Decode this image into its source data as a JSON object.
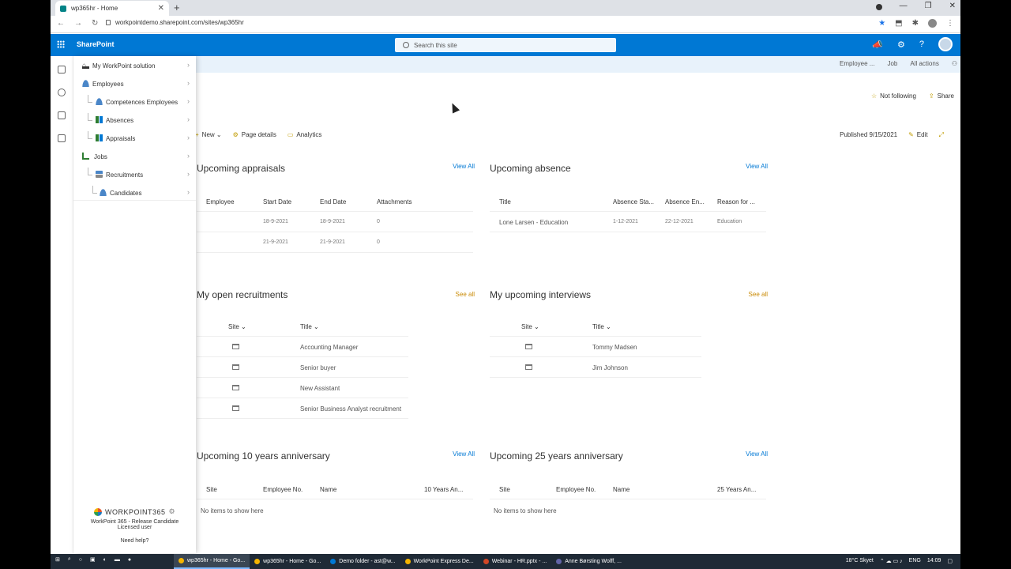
{
  "browser": {
    "tab_title": "wp365hr - Home",
    "url": "workpointdemo.sharepoint.com/sites/wp365hr"
  },
  "suite": {
    "brand": "SharePoint",
    "search_placeholder": "Search this site"
  },
  "topbar": {
    "employee": "Employee ...",
    "job": "Job",
    "all_actions": "All actions"
  },
  "page_actions": {
    "follow": "Not following",
    "share": "Share"
  },
  "command": {
    "new": "New",
    "page_details": "Page details",
    "analytics": "Analytics",
    "published": "Published 9/15/2021",
    "edit": "Edit"
  },
  "nav": {
    "items": [
      {
        "label": "My WorkPoint solution"
      },
      {
        "label": "Employees"
      },
      {
        "label": "Competences Employees"
      },
      {
        "label": "Absences"
      },
      {
        "label": "Appraisals"
      },
      {
        "label": "Jobs"
      },
      {
        "label": "Recruitments"
      },
      {
        "label": "Candidates"
      }
    ],
    "footer": {
      "logo": "WORKPOINT365",
      "line1": "WorkPoint 365 - Release Candidate",
      "line2": "Licensed user",
      "help": "Need help?"
    }
  },
  "appraisals": {
    "title": "Upcoming appraisals",
    "link": "View All",
    "headers": [
      "Employee",
      "Start Date",
      "End Date",
      "Attachments"
    ],
    "rows": [
      [
        "",
        "18-9-2021",
        "18-9-2021",
        "0"
      ],
      [
        "",
        "21-9-2021",
        "21-9-2021",
        "0"
      ]
    ]
  },
  "absence": {
    "title": "Upcoming absence",
    "link": "View All",
    "headers": [
      "Title",
      "Absence Sta...",
      "Absence En...",
      "Reason for ..."
    ],
    "rows": [
      [
        "Lone Larsen - Education",
        "1-12-2021",
        "22-12-2021",
        "Education"
      ]
    ]
  },
  "recruitments": {
    "title": "My open recruitments",
    "link": "See all",
    "headers": [
      "Site",
      "Title"
    ],
    "rows": [
      [
        "Accounting Manager"
      ],
      [
        "Senior buyer"
      ],
      [
        "New Assistant"
      ],
      [
        "Senior Business Analyst recruitment"
      ]
    ]
  },
  "interviews": {
    "title": "My upcoming interviews",
    "link": "See all",
    "headers": [
      "Site",
      "Title"
    ],
    "rows": [
      [
        "Tommy Madsen"
      ],
      [
        "Jim Johnson"
      ]
    ]
  },
  "anniv10": {
    "title": "Upcoming 10 years anniversary",
    "link": "View All",
    "headers": [
      "Site",
      "Employee No.",
      "Name",
      "10 Years An..."
    ],
    "empty": "No items to show here"
  },
  "anniv25": {
    "title": "Upcoming 25 years anniversary",
    "link": "View All",
    "headers": [
      "Site",
      "Employee No.",
      "Name",
      "25 Years An..."
    ],
    "empty": "No items to show here"
  },
  "taskbar": {
    "apps": [
      "wp365hr - Home - Go...",
      "wp365hr - Home - Go...",
      "Demo folder - ast@w...",
      "WorkPoint Express De...",
      "Webinar - HR.pptx - ...",
      "Anne Børsting Wolff, ..."
    ],
    "weather": "18°C Skyet",
    "lang": "ENG",
    "time": "14:09"
  }
}
